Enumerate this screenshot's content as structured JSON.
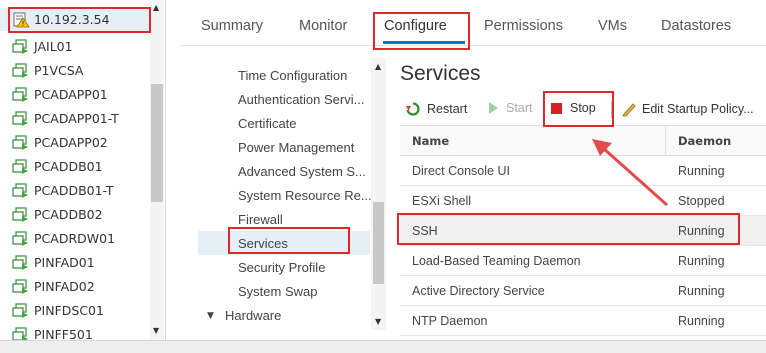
{
  "tree": {
    "host": "10.192.3.54",
    "vms": [
      "JAIL01",
      "P1VCSA",
      "PCADAPP01",
      "PCADAPP01-T",
      "PCADAPP02",
      "PCADDB01",
      "PCADDB01-T",
      "PCADDB02",
      "PCADRDW01",
      "PINFAD01",
      "PINFAD02",
      "PINFDSC01",
      "PINFF501"
    ]
  },
  "tabs": [
    "Summary",
    "Monitor",
    "Configure",
    "Permissions",
    "VMs",
    "Datastores"
  ],
  "active_tab": "Configure",
  "nav": {
    "items": [
      "Time Configuration",
      "Authentication Servi...",
      "Certificate",
      "Power Management",
      "Advanced System S...",
      "System Resource Re...",
      "Firewall",
      "Services",
      "Security Profile",
      "System Swap"
    ],
    "selected": "Services",
    "section": "Hardware"
  },
  "services": {
    "title": "Services",
    "toolbar": {
      "restart": "Restart",
      "start": "Start",
      "stop": "Stop",
      "edit": "Edit Startup Policy..."
    },
    "columns": [
      "Name",
      "Daemon"
    ],
    "rows": [
      {
        "name": "Direct Console UI",
        "daemon": "Running"
      },
      {
        "name": "ESXi Shell",
        "daemon": "Stopped"
      },
      {
        "name": "SSH",
        "daemon": "Running"
      },
      {
        "name": "Load-Based Teaming Daemon",
        "daemon": "Running"
      },
      {
        "name": "Active Directory Service",
        "daemon": "Running"
      },
      {
        "name": "NTP Daemon",
        "daemon": "Running"
      }
    ],
    "selected_row": "SSH"
  },
  "colors": {
    "highlight": "#e0272a",
    "accent": "#0079b8",
    "arrow": "#e24b4b"
  }
}
